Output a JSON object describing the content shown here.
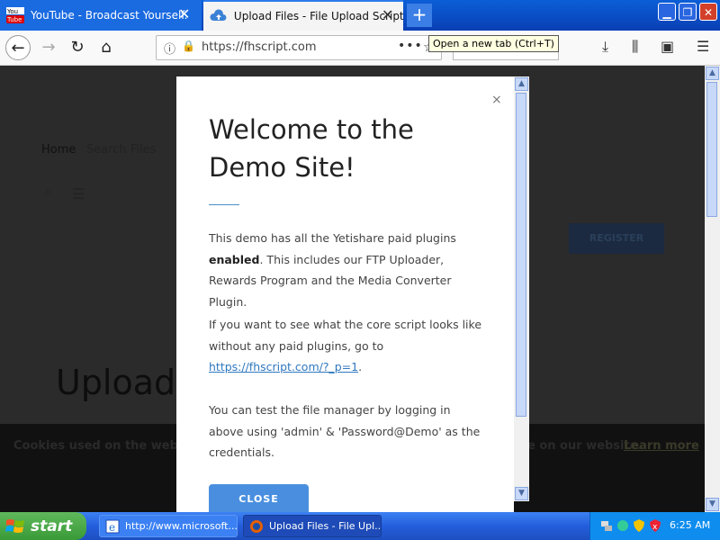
{
  "browser": {
    "tabs": [
      {
        "label": "YouTube - Broadcast Yourself.",
        "favicon": "youtube-icon",
        "active": false
      },
      {
        "label": "Upload Files - File Upload Script",
        "favicon": "cloud-upload-icon",
        "active": true
      }
    ],
    "new_tab_symbol": "+",
    "tooltip": "Open a new tab (Ctrl+T)",
    "url": "https://fhscript.com",
    "colors": {
      "tab_strip": "#0a3fb5",
      "active_tab": "#f4f4f4"
    }
  },
  "page": {
    "breadcrumb_home": "Home",
    "breadcrumb_search": "Search Files",
    "register_button": "REGISTER",
    "hero_text": "Upload,",
    "cookie_text_left": "Cookies used on the website",
    "cookie_text_right": "e on our website.",
    "cookie_learn_more": "Learn more"
  },
  "modal": {
    "close_symbol": "×",
    "title": "Welcome to the Demo Site!",
    "p1_prefix": "This demo has all the Yetishare paid plugins ",
    "p1_bold": "enabled",
    "p1_suffix": ". This includes our FTP Uploader, Rewards Program and the Media Converter Plugin.",
    "p2_prefix": "If you want to see what the core script looks like without any paid plugins, go to ",
    "p2_link": "https://fhscript.com/?_p=1",
    "p2_suffix": ".",
    "p3": "You can test the file manager by logging in above using 'admin' & 'Password@Demo' as the credentials.",
    "close_button": "CLOSE",
    "accent_color": "#4a8fdf"
  },
  "taskbar": {
    "start_label": "start",
    "items": [
      {
        "label": "http://www.microsoft...",
        "icon": "ie-icon"
      },
      {
        "label": "Upload Files - File Upl...",
        "icon": "firefox-icon"
      }
    ],
    "clock": "6:25 AM"
  }
}
